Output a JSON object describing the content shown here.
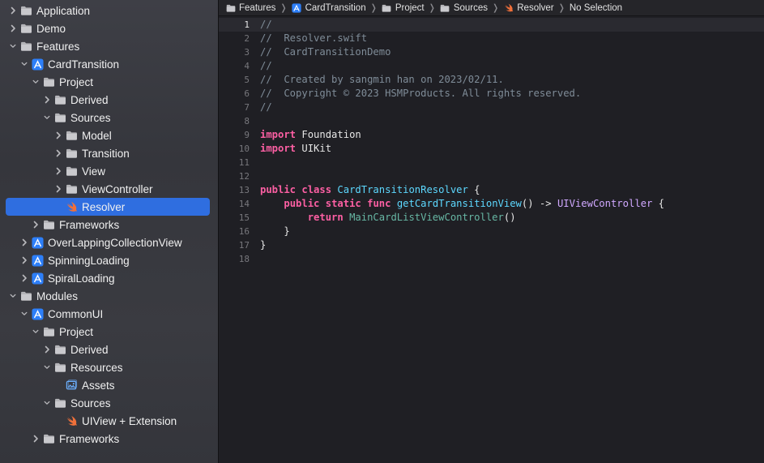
{
  "sidebar": {
    "items": [
      {
        "label": "Application",
        "depth": 0,
        "chevron": "right",
        "icon": "folder"
      },
      {
        "label": "Demo",
        "depth": 0,
        "chevron": "right",
        "icon": "folder"
      },
      {
        "label": "Features",
        "depth": 0,
        "chevron": "down",
        "icon": "folder"
      },
      {
        "label": "CardTransition",
        "depth": 1,
        "chevron": "down",
        "icon": "xcode-project"
      },
      {
        "label": "Project",
        "depth": 2,
        "chevron": "down",
        "icon": "folder"
      },
      {
        "label": "Derived",
        "depth": 3,
        "chevron": "right",
        "icon": "folder"
      },
      {
        "label": "Sources",
        "depth": 3,
        "chevron": "down",
        "icon": "folder"
      },
      {
        "label": "Model",
        "depth": 4,
        "chevron": "right",
        "icon": "folder"
      },
      {
        "label": "Transition",
        "depth": 4,
        "chevron": "right",
        "icon": "folder"
      },
      {
        "label": "View",
        "depth": 4,
        "chevron": "right",
        "icon": "folder"
      },
      {
        "label": "ViewController",
        "depth": 4,
        "chevron": "right",
        "icon": "folder"
      },
      {
        "label": "Resolver",
        "depth": 4,
        "chevron": "none",
        "icon": "swift",
        "selected": true
      },
      {
        "label": "Frameworks",
        "depth": 2,
        "chevron": "right",
        "icon": "folder"
      },
      {
        "label": "OverLappingCollectionView",
        "depth": 1,
        "chevron": "right",
        "icon": "xcode-project"
      },
      {
        "label": "SpinningLoading",
        "depth": 1,
        "chevron": "right",
        "icon": "xcode-project"
      },
      {
        "label": "SpiralLoading",
        "depth": 1,
        "chevron": "right",
        "icon": "xcode-project"
      },
      {
        "label": "Modules",
        "depth": 0,
        "chevron": "down",
        "icon": "folder"
      },
      {
        "label": "CommonUI",
        "depth": 1,
        "chevron": "down",
        "icon": "xcode-project"
      },
      {
        "label": "Project",
        "depth": 2,
        "chevron": "down",
        "icon": "folder"
      },
      {
        "label": "Derived",
        "depth": 3,
        "chevron": "right",
        "icon": "folder"
      },
      {
        "label": "Resources",
        "depth": 3,
        "chevron": "down",
        "icon": "folder"
      },
      {
        "label": "Assets",
        "depth": 4,
        "chevron": "none",
        "icon": "assets"
      },
      {
        "label": "Sources",
        "depth": 3,
        "chevron": "down",
        "icon": "folder"
      },
      {
        "label": "UIView + Extension",
        "depth": 4,
        "chevron": "none",
        "icon": "swift"
      },
      {
        "label": "Frameworks",
        "depth": 2,
        "chevron": "right",
        "icon": "folder"
      }
    ]
  },
  "breadcrumb": [
    {
      "label": "Features",
      "icon": "folder"
    },
    {
      "label": "CardTransition",
      "icon": "xcode-project"
    },
    {
      "label": "Project",
      "icon": "folder"
    },
    {
      "label": "Sources",
      "icon": "folder"
    },
    {
      "label": "Resolver",
      "icon": "swift"
    },
    {
      "label": "No Selection",
      "icon": "none"
    }
  ],
  "editor": {
    "current_line": 1,
    "lines": [
      {
        "n": "1",
        "tokens": [
          {
            "t": "//",
            "c": "comment"
          }
        ]
      },
      {
        "n": "2",
        "tokens": [
          {
            "t": "//  Resolver.swift",
            "c": "comment"
          }
        ]
      },
      {
        "n": "3",
        "tokens": [
          {
            "t": "//  CardTransitionDemo",
            "c": "comment"
          }
        ]
      },
      {
        "n": "4",
        "tokens": [
          {
            "t": "//",
            "c": "comment"
          }
        ]
      },
      {
        "n": "5",
        "tokens": [
          {
            "t": "//  Created by sangmin han on 2023/02/11.",
            "c": "comment"
          }
        ]
      },
      {
        "n": "6",
        "tokens": [
          {
            "t": "//  Copyright © 2023 HSMProducts. All rights reserved.",
            "c": "comment"
          }
        ]
      },
      {
        "n": "7",
        "tokens": [
          {
            "t": "//",
            "c": "comment"
          }
        ]
      },
      {
        "n": "8",
        "tokens": []
      },
      {
        "n": "9",
        "tokens": [
          {
            "t": "import",
            "c": "kw"
          },
          {
            "t": " Foundation",
            "c": "plain"
          }
        ]
      },
      {
        "n": "10",
        "tokens": [
          {
            "t": "import",
            "c": "kw"
          },
          {
            "t": " UIKit",
            "c": "plain"
          }
        ]
      },
      {
        "n": "11",
        "tokens": []
      },
      {
        "n": "12",
        "tokens": []
      },
      {
        "n": "13",
        "tokens": [
          {
            "t": "public",
            "c": "kw"
          },
          {
            "t": " ",
            "c": "plain"
          },
          {
            "t": "class",
            "c": "kw"
          },
          {
            "t": " ",
            "c": "plain"
          },
          {
            "t": "CardTransitionResolver",
            "c": "decl"
          },
          {
            "t": " {",
            "c": "plain"
          }
        ]
      },
      {
        "n": "14",
        "tokens": [
          {
            "t": "    ",
            "c": "plain"
          },
          {
            "t": "public",
            "c": "kw"
          },
          {
            "t": " ",
            "c": "plain"
          },
          {
            "t": "static",
            "c": "kw"
          },
          {
            "t": " ",
            "c": "plain"
          },
          {
            "t": "func",
            "c": "kw"
          },
          {
            "t": " ",
            "c": "plain"
          },
          {
            "t": "getCardTransitionView",
            "c": "decl"
          },
          {
            "t": "() -> ",
            "c": "plain"
          },
          {
            "t": "UIViewController",
            "c": "type"
          },
          {
            "t": " {",
            "c": "plain"
          }
        ]
      },
      {
        "n": "15",
        "tokens": [
          {
            "t": "        ",
            "c": "plain"
          },
          {
            "t": "return",
            "c": "kw"
          },
          {
            "t": " ",
            "c": "plain"
          },
          {
            "t": "MainCardListViewController",
            "c": "fn"
          },
          {
            "t": "()",
            "c": "plain"
          }
        ]
      },
      {
        "n": "16",
        "tokens": [
          {
            "t": "    }",
            "c": "plain"
          }
        ]
      },
      {
        "n": "17",
        "tokens": [
          {
            "t": "}",
            "c": "plain"
          }
        ]
      },
      {
        "n": "18",
        "tokens": []
      }
    ]
  },
  "colors": {
    "selection": "#2f6ee0",
    "folder": "#b4b4b8",
    "project_blue": "#2d7ff9",
    "swift_orange": "#f0703a",
    "keyword": "#fc5fa3",
    "declaration": "#5dd8ff",
    "type": "#d0a8ff",
    "function": "#67b7a4",
    "comment": "#7f8c98"
  }
}
